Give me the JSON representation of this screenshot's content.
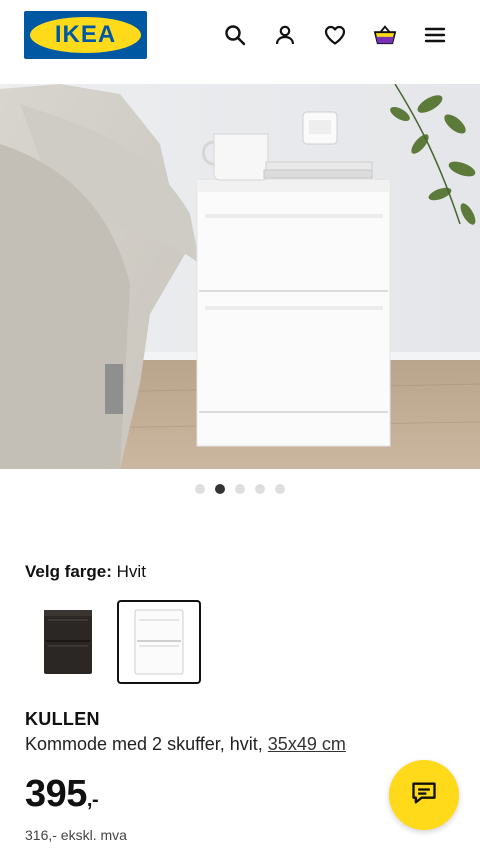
{
  "header": {
    "logo_text": "IKEA",
    "icons": [
      "search-icon",
      "user-icon",
      "heart-icon",
      "basket-icon",
      "menu-icon"
    ],
    "brand_blue": "#0058a3",
    "brand_yellow": "#ffda1a"
  },
  "gallery": {
    "slide_count": 5,
    "active_index": 1
  },
  "color_picker": {
    "label": "Velg farge:",
    "selected": "Hvit",
    "options": [
      "black-brown",
      "white"
    ]
  },
  "product": {
    "name": "KULLEN",
    "description": "Kommode med 2 skuffer, hvit,",
    "dimensions": "35x49 cm",
    "price": "395",
    "price_suffix": ",-",
    "price_ex_vat": "316,- ekskl. mva"
  },
  "chat": {
    "icon": "chat-icon"
  }
}
